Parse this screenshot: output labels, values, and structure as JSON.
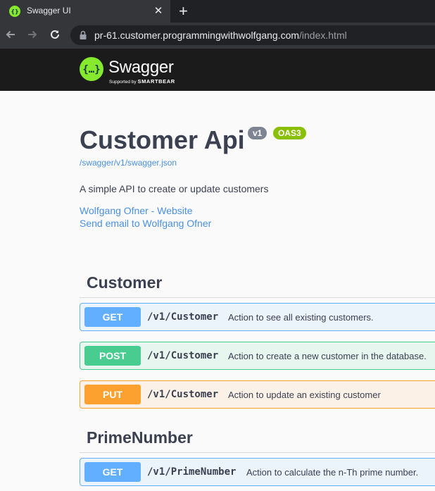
{
  "browser": {
    "tab_title": "Swagger UI",
    "tab_close": "✕",
    "new_tab": "+",
    "url_host": "pr-61.customer.programmingwithwolfgang.com",
    "url_path": "/index.html",
    "icons": {
      "favicon": "swagger-favicon-icon",
      "back": "back-arrow-icon",
      "forward": "forward-arrow-icon",
      "reload": "reload-icon",
      "lock": "lock-icon"
    }
  },
  "topbar": {
    "logo_text": "Swagger",
    "logo_sub_prefix": "Supported by",
    "logo_sub_brand": "SMARTBEAR"
  },
  "info": {
    "title": "Customer Api",
    "version_badge": "v1",
    "oas_badge": "OAS3",
    "spec_url": "/swagger/v1/swagger.json",
    "description": "A simple API to create or update customers",
    "website_link": "Wolfgang Ofner - Website",
    "email_link": "Send email to Wolfgang Ofner"
  },
  "sections": [
    {
      "name": "Customer",
      "operations": [
        {
          "method": "GET",
          "path": "/v1/Customer",
          "summary": "Action to see all existing customers."
        },
        {
          "method": "POST",
          "path": "/v1/Customer",
          "summary": "Action to create a new customer in the database."
        },
        {
          "method": "PUT",
          "path": "/v1/Customer",
          "summary": "Action to update an existing customer"
        }
      ]
    },
    {
      "name": "PrimeNumber",
      "operations": [
        {
          "method": "GET",
          "path": "/v1/PrimeNumber",
          "summary": "Action to calculate the n-Th prime number."
        }
      ]
    }
  ],
  "colors": {
    "get": "#61affe",
    "post": "#49cc90",
    "put": "#fca130",
    "swagger_green": "#85ea2d",
    "link": "#4990e2",
    "text": "#3b4151"
  }
}
